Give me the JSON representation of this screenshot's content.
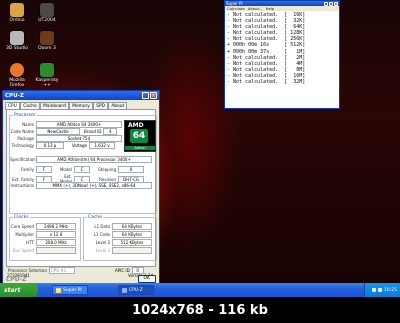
{
  "desktop": {
    "icons": [
      {
        "label": "Ordino",
        "name": "ordino-icon",
        "color": "#d9a441"
      },
      {
        "label": "UT2004",
        "name": "ut2004-icon",
        "color": "#4a4a4a"
      },
      {
        "label": "3D Studio",
        "name": "3dstudio-icon",
        "color": "#b8b8b8"
      },
      {
        "label": "Doom 3",
        "name": "doom3-icon",
        "color": "#6c3a1c"
      },
      {
        "label": "Mozilla Firefox",
        "name": "firefox-icon",
        "color": "#e8762b"
      },
      {
        "label": "Kaspersky++",
        "name": "kaspersky-icon",
        "color": "#2c8c2c"
      }
    ]
  },
  "cpuz": {
    "title": "CPU-Z",
    "tabs": [
      "CPU",
      "Cache",
      "Mainboard",
      "Memory",
      "SPD",
      "About"
    ],
    "processor_title": "Processor",
    "name_label": "Name",
    "name_value": "AMD Athlon 64 3400+",
    "codename_label": "Code Name",
    "codename_value": "NewCastle",
    "brand_id_label": "Brand ID",
    "brand_id_value": "4",
    "package_label": "Package",
    "package_value": "Socket 754",
    "technology_label": "Technology",
    "technology_value": "0.13 µ",
    "voltage_label": "Voltage",
    "voltage_value": "1.632 v",
    "specification_label": "Specification",
    "specification_value": "AMD Athlon(tm) 64 Processor 3400+",
    "family_label": "Family",
    "family_value": "F",
    "model_label": "Model",
    "model_value": "C",
    "stepping_label": "Stepping",
    "stepping_value": "0",
    "extfamily_label": "Ext. Family",
    "extfamily_value": "F",
    "extmodel_label": "Ext. Model",
    "extmodel_value": "C",
    "revision_label": "Revision",
    "revision_value": "DH7-CG",
    "instructions_label": "Instructions",
    "instructions_value": "MMX (+), 3DNow! (+), SSE, SSE2, x86-64",
    "logo": {
      "brand": "AMD",
      "num": "64",
      "sub": "Athlon"
    },
    "clocks_title": "Clocks",
    "core_speed_label": "Core Speed",
    "core_speed_value": "2496.2 MHz",
    "multiplier_label": "Multiplier",
    "multiplier_value": "x 12.0",
    "htt_label": "HTT",
    "htt_value": "208.0 MHz",
    "busspeed_label": "Bus Speed",
    "busspeed_value": "",
    "cache_title": "Cache",
    "l1data_label": "L1 Data",
    "l1data_value": "64 KBytes",
    "l1code_label": "L1 Code",
    "l1code_value": "64 KBytes",
    "level2_label": "Level 2",
    "level2_value": "512 KBytes",
    "level3_label": "Level 3",
    "level3_value": "",
    "proc_selection_label": "Processor Selection",
    "proc_selection_value": "CPU #1",
    "apic_label": "APIC ID",
    "apic_value": "0",
    "id_value": "273281941",
    "version_value": "Version 1.24",
    "brandmark": "CPU-Z",
    "ok_label": "OK"
  },
  "superpi": {
    "title": "Super PI",
    "menus": [
      "Calculate",
      "About...",
      "Help"
    ],
    "lines": [
      "- Not calculated.  [  16K]",
      "- Not calculated.  [  32K]",
      "- Not calculated.  [  64K]",
      "- Not calculated.  [ 128K]",
      "- Not calculated.  [ 256K]",
      "+ 000h 00m 16s     [ 512K]",
      "+ 000h 00m 37s     [   1M]",
      "- Not calculated.  [   2M]",
      "- Not calculated.  [   4M]",
      "- Not calculated.  [   8M]",
      "- Not calculated.  [  16M]",
      "- Not calculated.  [  32M]"
    ]
  },
  "taskbar": {
    "start_label": "start",
    "items": [
      "Super PI",
      "CPU-Z"
    ],
    "clock": "16:25"
  },
  "info_caption": "1024x768 - 116 kb"
}
